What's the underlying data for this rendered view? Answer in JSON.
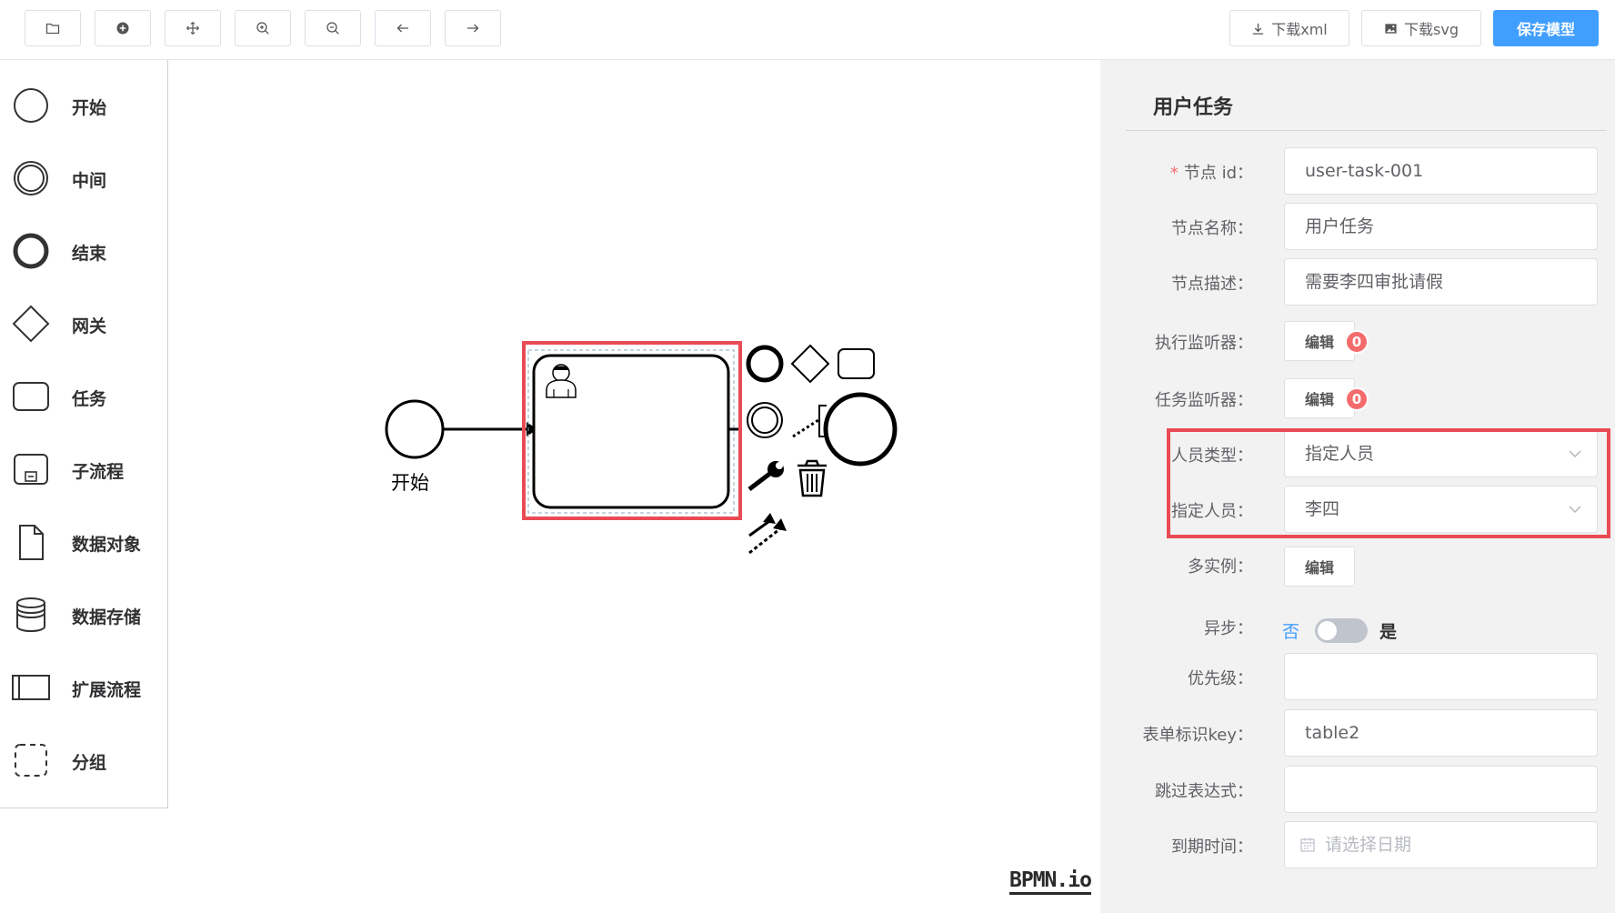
{
  "toolbar": {
    "left_buttons": [
      {
        "icon": "folder-open-icon"
      },
      {
        "icon": "plus-circle-icon"
      },
      {
        "icon": "move-icon"
      },
      {
        "icon": "zoom-in-icon"
      },
      {
        "icon": "zoom-out-icon"
      },
      {
        "icon": "undo-arrow-icon"
      },
      {
        "icon": "redo-arrow-icon"
      }
    ],
    "download_xml": "下载xml",
    "download_svg": "下载svg",
    "save_model": "保存模型",
    "primary_color": "#409eff"
  },
  "palette": {
    "items": [
      {
        "label": "开始",
        "icon": "start-event-icon"
      },
      {
        "label": "中间",
        "icon": "intermediate-event-icon"
      },
      {
        "label": "结束",
        "icon": "end-event-icon"
      },
      {
        "label": "网关",
        "icon": "gateway-icon"
      },
      {
        "label": "任务",
        "icon": "task-icon"
      },
      {
        "label": "子流程",
        "icon": "subprocess-icon"
      },
      {
        "label": "数据对象",
        "icon": "data-object-icon"
      },
      {
        "label": "数据存储",
        "icon": "data-store-icon"
      },
      {
        "label": "扩展流程",
        "icon": "pool-icon"
      },
      {
        "label": "分组",
        "icon": "group-icon"
      }
    ]
  },
  "canvas": {
    "start_event_label": "开始",
    "watermark": "BPMN.io",
    "highlight_color": "#e94b55"
  },
  "panel": {
    "title": "用户任务",
    "fields": {
      "node_id": {
        "label": "节点 id：",
        "value": "user-task-001",
        "required_mark": "*"
      },
      "node_name": {
        "label": "节点名称：",
        "value": "用户任务"
      },
      "node_desc": {
        "label": "节点描述：",
        "value": "需要李四审批请假"
      },
      "exec_listener": {
        "label": "执行监听器：",
        "button": "编辑",
        "count": "0"
      },
      "task_listener": {
        "label": "任务监听器：",
        "button": "编辑",
        "count": "0"
      },
      "assignee_type": {
        "label": "人员类型：",
        "value": "指定人员"
      },
      "assignee": {
        "label": "指定人员：",
        "value": "李四"
      },
      "multi_instance": {
        "label": "多实例：",
        "button": "编辑"
      },
      "async": {
        "label": "异步：",
        "off_text": "否",
        "on_text": "是"
      },
      "priority": {
        "label": "优先级：",
        "value": ""
      },
      "form_key": {
        "label": "表单标识key：",
        "value": "table2"
      },
      "skip_expr": {
        "label": "跳过表达式：",
        "value": ""
      },
      "due_date": {
        "label": "到期时间：",
        "placeholder": "请选择日期"
      }
    }
  }
}
